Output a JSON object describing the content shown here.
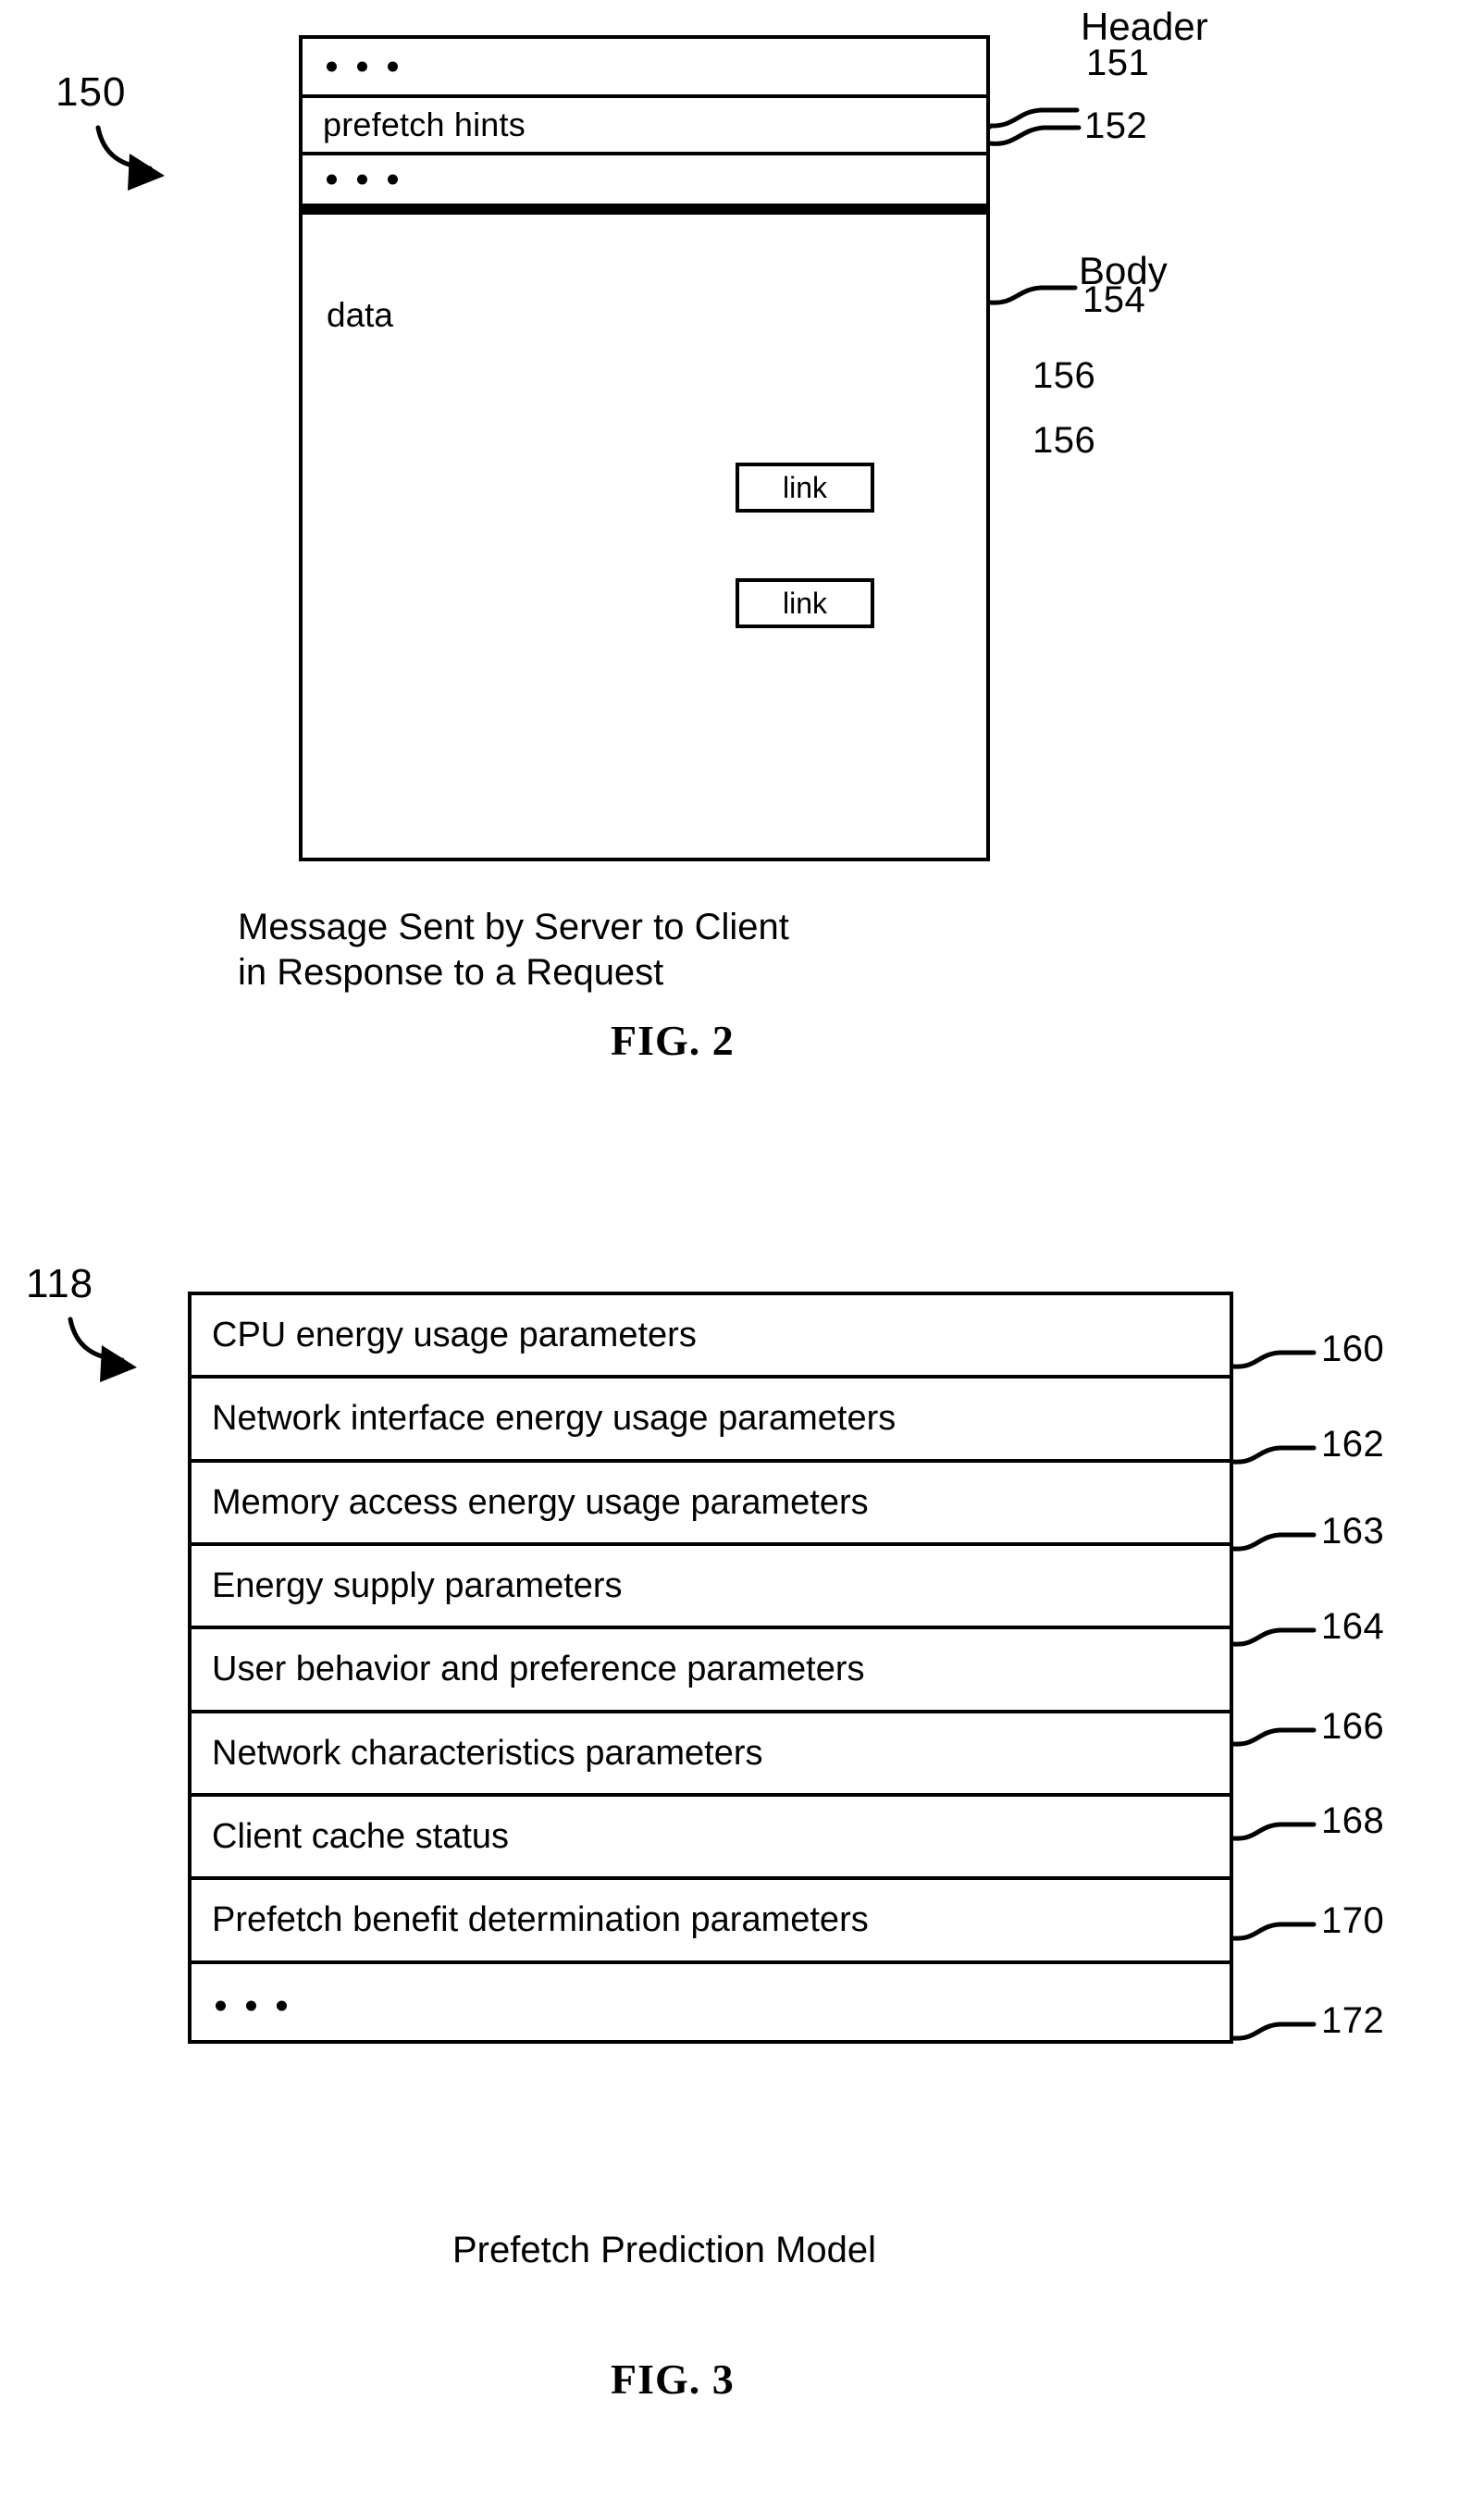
{
  "figure2": {
    "ref_number": "150",
    "message_box": {
      "rows": [
        {
          "type": "ellipsis",
          "text": "· · ·",
          "ref": "151"
        },
        {
          "type": "text",
          "text": "prefetch hints",
          "ref": "152"
        },
        {
          "type": "ellipsis",
          "text": "· · ·",
          "ref": ""
        }
      ],
      "body": {
        "label": "data",
        "ref": "154",
        "links": [
          {
            "text": "link",
            "ref": "156"
          },
          {
            "text": "link",
            "ref": "156"
          }
        ]
      }
    },
    "section_labels": {
      "header": "Header",
      "body": "Body"
    },
    "ref_numbers": {
      "header_151": "151",
      "prefetch_hints_152": "152",
      "body_154": "154",
      "link_156_a": "156",
      "link_156_b": "156"
    },
    "caption": "Message Sent by Server to Client\nin Response to a Request",
    "figure_title": "FIG. 2"
  },
  "figure3": {
    "ref_number": "118",
    "model_box": {
      "rows": [
        {
          "label": "CPU energy usage parameters",
          "ref": "160"
        },
        {
          "label": "Network interface energy usage parameters",
          "ref": "162"
        },
        {
          "label": "Memory access energy usage parameters",
          "ref": "163"
        },
        {
          "label": "Energy supply parameters",
          "ref": "164"
        },
        {
          "label": "User behavior and preference parameters",
          "ref": "166"
        },
        {
          "label": "Network characteristics parameters",
          "ref": "168"
        },
        {
          "label": "Client cache status",
          "ref": "170"
        },
        {
          "label": "Prefetch benefit determination parameters",
          "ref": "172"
        },
        {
          "label": "· · ·",
          "ref": ""
        }
      ]
    },
    "caption": "Prefetch Prediction Model",
    "figure_title": "FIG. 3"
  },
  "colors": {
    "ink": "#000000",
    "paper": "#ffffff"
  }
}
